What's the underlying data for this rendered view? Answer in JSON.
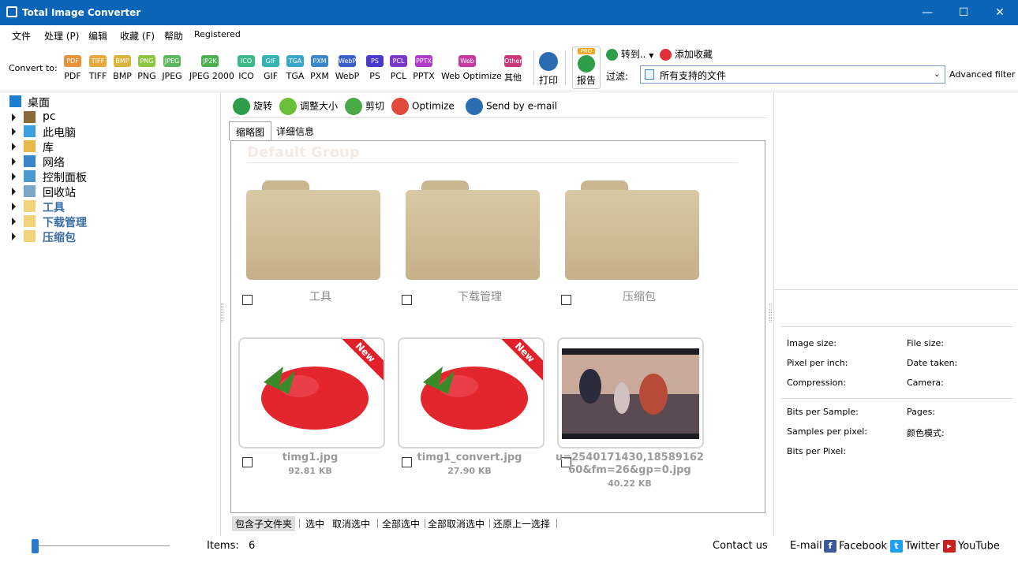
{
  "window": {
    "title": "Total Image Converter"
  },
  "menu": [
    "文件",
    "处理 (P)",
    "编辑",
    "收藏 (F)",
    "帮助",
    "Registered"
  ],
  "toolbar": {
    "convert_to": "Convert to:",
    "formats": [
      {
        "badge": "PDF",
        "label": "PDF",
        "color": "#e8923a"
      },
      {
        "badge": "TIFF",
        "label": "TIFF",
        "color": "#e8a93a"
      },
      {
        "badge": "BMP",
        "label": "BMP",
        "color": "#d9b43a"
      },
      {
        "badge": "PNG",
        "label": "PNG",
        "color": "#8cc63f"
      },
      {
        "badge": "JPEG",
        "label": "JPEG",
        "color": "#5cb85c"
      },
      {
        "badge": "JP2K",
        "label": "JPEG 2000",
        "color": "#4caf50"
      },
      {
        "badge": "ICO",
        "label": "ICO",
        "color": "#3fb98b"
      },
      {
        "badge": "GIF",
        "label": "GIF",
        "color": "#36b3b0"
      },
      {
        "badge": "TGA",
        "label": "TGA",
        "color": "#3aa6c9"
      },
      {
        "badge": "PXM",
        "label": "PXM",
        "color": "#3a86c9"
      },
      {
        "badge": "WebP",
        "label": "WebP",
        "color": "#3a5fc9"
      },
      {
        "badge": "PS",
        "label": "PS",
        "color": "#4a3ac9"
      },
      {
        "badge": "PCL",
        "label": "PCL",
        "color": "#7a3ac9"
      },
      {
        "badge": "PPTX",
        "label": "PPTX",
        "color": "#b03ac9"
      },
      {
        "badge": "Web",
        "label": "Web Optimize",
        "color": "#c93aa0"
      },
      {
        "badge": "Other",
        "label": "其他",
        "color": "#c93a7a"
      }
    ],
    "print": "打印",
    "report": "报告",
    "report_badge": "PRO",
    "goto": "转到..",
    "add_favorite": "添加收藏",
    "filter_label": "过滤:",
    "filter_value": "所有支持的文件",
    "advanced_filter": "Advanced filter"
  },
  "tree": [
    {
      "label": "桌面",
      "icon": "desktop-icon",
      "color": "#1e7fd0",
      "expandable": false,
      "bold": false
    },
    {
      "label": "pc",
      "icon": "user-icon",
      "color": "#8a6a3a",
      "expandable": true,
      "bold": false
    },
    {
      "label": "此电脑",
      "icon": "computer-icon",
      "color": "#3aa0e0",
      "expandable": true,
      "bold": false
    },
    {
      "label": "库",
      "icon": "library-icon",
      "color": "#e8b84a",
      "expandable": true,
      "bold": false
    },
    {
      "label": "网络",
      "icon": "network-icon",
      "color": "#3a86c9",
      "expandable": true,
      "bold": false
    },
    {
      "label": "控制面板",
      "icon": "control-panel-icon",
      "color": "#4a9ad0",
      "expandable": true,
      "bold": false
    },
    {
      "label": "回收站",
      "icon": "recycle-bin-icon",
      "color": "#7aa7c7",
      "expandable": true,
      "bold": false
    },
    {
      "label": "工具",
      "icon": "folder-icon",
      "color": "#f2d27a",
      "expandable": true,
      "bold": true
    },
    {
      "label": "下载管理",
      "icon": "folder-icon",
      "color": "#f2d27a",
      "expandable": true,
      "bold": true
    },
    {
      "label": "压缩包",
      "icon": "folder-icon",
      "color": "#f2d27a",
      "expandable": true,
      "bold": true
    }
  ],
  "actions": [
    {
      "label": "旋转",
      "icon": "rotate-icon",
      "color": "#2e9e4a"
    },
    {
      "label": "调整大小",
      "icon": "resize-icon",
      "color": "#6abf3a"
    },
    {
      "label": "剪切",
      "icon": "crop-icon",
      "color": "#4aaa4a"
    },
    {
      "label": "Optimize",
      "icon": "optimize-icon",
      "color": "#e04a3a"
    },
    {
      "label": "Send by e-mail",
      "icon": "email-icon",
      "color": "#2a6db0"
    }
  ],
  "tabs": [
    "缩略图",
    "详细信息"
  ],
  "group_title": "Default Group",
  "folders": [
    "工具",
    "下载管理",
    "压缩包"
  ],
  "files": [
    {
      "name": "timg1.jpg",
      "size": "92.81 KB",
      "badge": "New"
    },
    {
      "name": "timg1_convert.jpg",
      "size": "27.90 KB",
      "badge": "New"
    },
    {
      "name": "u=2540171430,1858916260&fm=26&gp=0.jpg",
      "name_line1": "u=2540171430,18589162",
      "name_line2": "60&fm=26&gp=0.jpg",
      "size": "40.22 KB",
      "badge": ""
    }
  ],
  "selection_links": [
    "包含子文件夹",
    "选中",
    "取消选中",
    "全部选中",
    "全部取消选中",
    "还原上一选择"
  ],
  "info": {
    "image_size": "Image size:",
    "file_size": "File size:",
    "ppi": "Pixel per inch:",
    "date_taken": "Date taken:",
    "compression": "Compression:",
    "camera": "Camera:",
    "bits_per_sample": "Bits per Sample:",
    "pages": "Pages:",
    "samples_per_pixel": "Samples per pixel:",
    "color_mode": "颜色模式:",
    "bits_per_pixel": "Bits per Pixel:"
  },
  "status": {
    "items_label": "Items:",
    "items_count": "6",
    "contact": "Contact us",
    "email": "E-mail",
    "facebook": "Facebook",
    "twitter": "Twitter",
    "youtube": "YouTube"
  }
}
